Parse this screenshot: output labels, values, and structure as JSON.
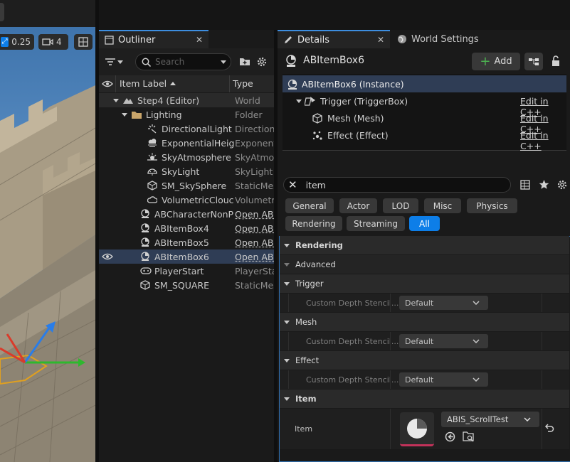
{
  "viewport": {
    "scale_value": "0.25",
    "camera_speed": "4"
  },
  "outliner": {
    "tab_label": "Outliner",
    "search_placeholder": "Search",
    "col_item_label": "Item Label",
    "col_type": "Type",
    "rows": [
      {
        "label": "Step4 (Editor)",
        "type": "World",
        "icon": "world-icon"
      },
      {
        "label": "Lighting",
        "type": "Folder",
        "icon": "folder-icon"
      },
      {
        "label": "DirectionalLight",
        "type": "Directiona",
        "icon": "directional-light-icon"
      },
      {
        "label": "ExponentialHeig",
        "type": "Exponenti",
        "icon": "fog-icon"
      },
      {
        "label": "SkyAtmosphere",
        "type": "SkyAtmos",
        "icon": "sky-atmosphere-icon"
      },
      {
        "label": "SkyLight",
        "type": "SkyLight",
        "icon": "skylight-icon"
      },
      {
        "label": "SM_SkySphere",
        "type": "StaticMes",
        "icon": "static-mesh-icon"
      },
      {
        "label": "VolumetricClouc",
        "type": "Volumetri",
        "icon": "cloud-icon"
      },
      {
        "label": "ABCharacterNonP",
        "type": "Open ABC",
        "icon": "character-icon"
      },
      {
        "label": "ABItemBox4",
        "type": "Open ABI",
        "icon": "actor-icon"
      },
      {
        "label": "ABItemBox5",
        "type": "Open ABI",
        "icon": "actor-icon"
      },
      {
        "label": "ABItemBox6",
        "type": "Open ABI",
        "icon": "actor-icon"
      },
      {
        "label": "PlayerStart",
        "type": "PlayerSta",
        "icon": "player-start-icon"
      },
      {
        "label": "SM_SQUARE",
        "type": "StaticMes",
        "icon": "static-mesh-icon"
      }
    ]
  },
  "details": {
    "tab_label": "Details",
    "world_settings_tab": "World Settings",
    "actor_name": "ABItemBox6",
    "add_label": "Add",
    "components": [
      {
        "label": "ABItemBox6 (Instance)",
        "edit": ""
      },
      {
        "label": "Trigger (TriggerBox)",
        "edit": "Edit in C++"
      },
      {
        "label": "Mesh (Mesh)",
        "edit": "Edit in C++"
      },
      {
        "label": "Effect (Effect)",
        "edit": "Edit in C++"
      }
    ],
    "search_value": "item",
    "filters": [
      "General",
      "Actor",
      "LOD",
      "Misc",
      "Physics",
      "Rendering",
      "Streaming",
      "All"
    ],
    "sections": {
      "rendering": "Rendering",
      "advanced": "Advanced",
      "trigger": "Trigger",
      "mesh": "Mesh",
      "effect": "Effect",
      "item": "Item"
    },
    "prop_custom_depth": "Custom Depth Stencil...",
    "prop_default": "Default",
    "item_label": "Item",
    "item_asset": "ABIS_ScrollTest"
  },
  "colors": {
    "accent": "#0d7ee8",
    "selected_row": "#2f3d55",
    "add_plus": "#4caf50"
  }
}
